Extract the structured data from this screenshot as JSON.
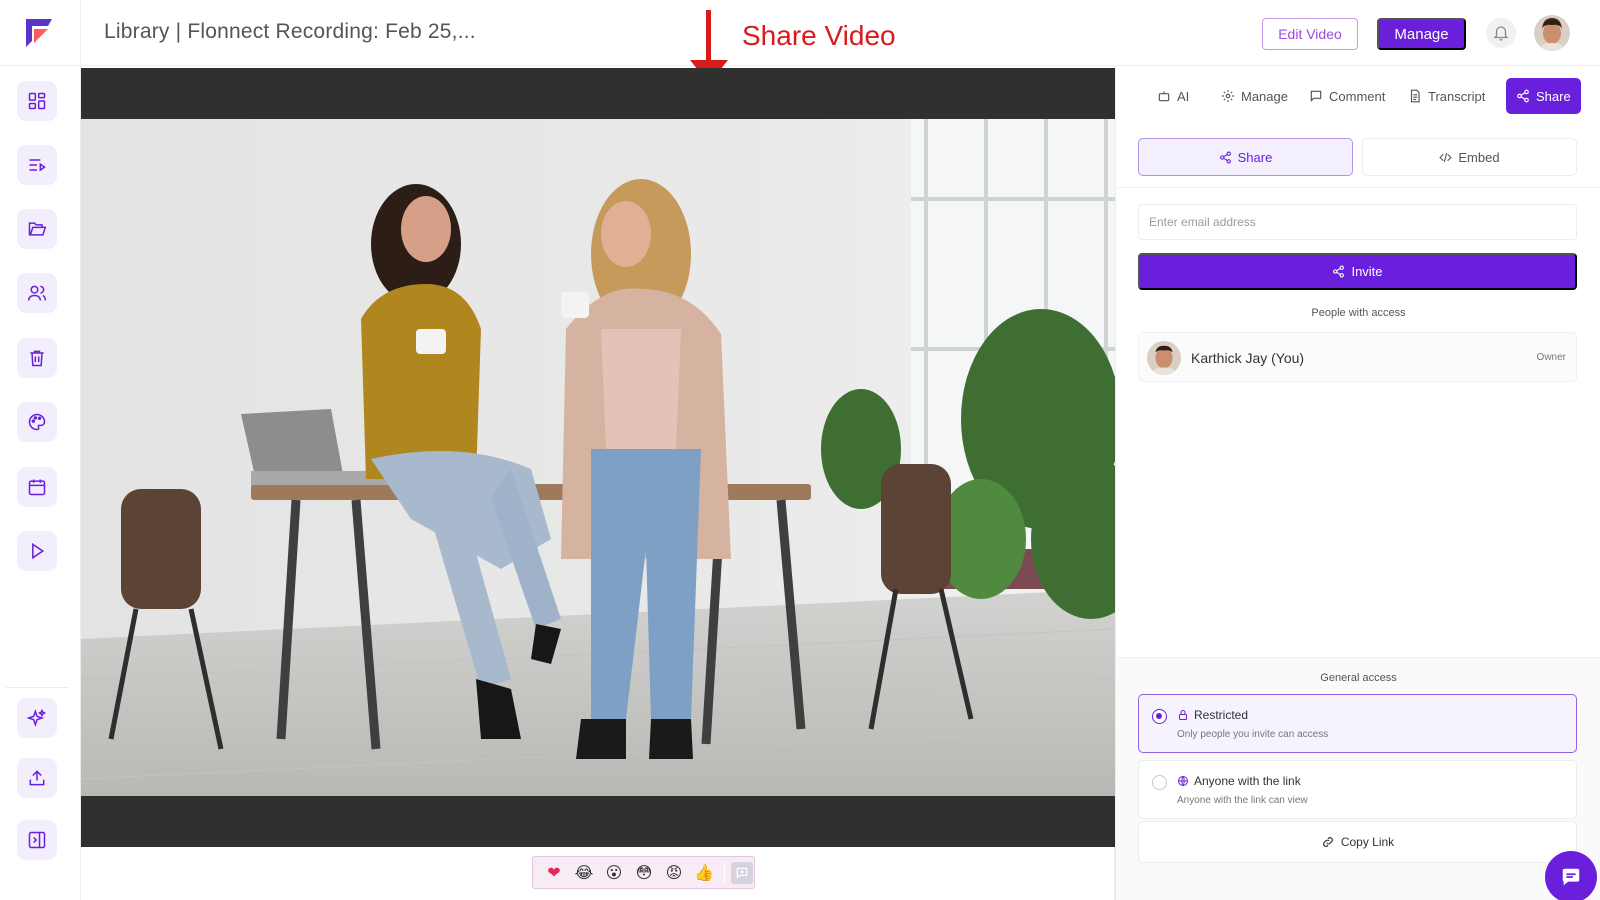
{
  "header": {
    "title": "Library | Flonnect Recording: Feb 25,...",
    "annotation": "Share Video",
    "edit_button": "Edit Video",
    "manage_button": "Manage"
  },
  "sidebar": {
    "items": [
      {
        "icon": "dashboard-icon"
      },
      {
        "icon": "playlist-icon"
      },
      {
        "icon": "folder-icon"
      },
      {
        "icon": "users-icon"
      },
      {
        "icon": "trash-icon"
      },
      {
        "icon": "palette-icon"
      },
      {
        "icon": "calendar-icon"
      },
      {
        "icon": "play-icon"
      }
    ],
    "bottom_items": [
      {
        "icon": "sparkle-icon"
      },
      {
        "icon": "upload-icon"
      },
      {
        "icon": "collapse-icon"
      }
    ]
  },
  "video": {
    "reactions": [
      "❤",
      "😂",
      "😮",
      "😳",
      "😡",
      "👍"
    ]
  },
  "panel": {
    "tabs": {
      "ai": "AI",
      "manage": "Manage",
      "comment": "Comment",
      "transcript": "Transcript",
      "share": "Share"
    },
    "subtabs": {
      "share": "Share",
      "embed": "Embed"
    },
    "email_placeholder": "Enter email address",
    "invite_button": "Invite",
    "people_label": "People with access",
    "person": {
      "name": "Karthick Jay (You)",
      "role": "Owner"
    },
    "general_access_label": "General access",
    "options": {
      "restricted": {
        "title": "Restricted",
        "desc": "Only people you invite can access"
      },
      "anyone": {
        "title": "Anyone with the link",
        "desc": "Anyone with the link can view"
      }
    },
    "copy_link": "Copy Link"
  },
  "colors": {
    "accent": "#6a1fdc",
    "annotation": "#d81b1b",
    "video_bar": "#303030"
  }
}
